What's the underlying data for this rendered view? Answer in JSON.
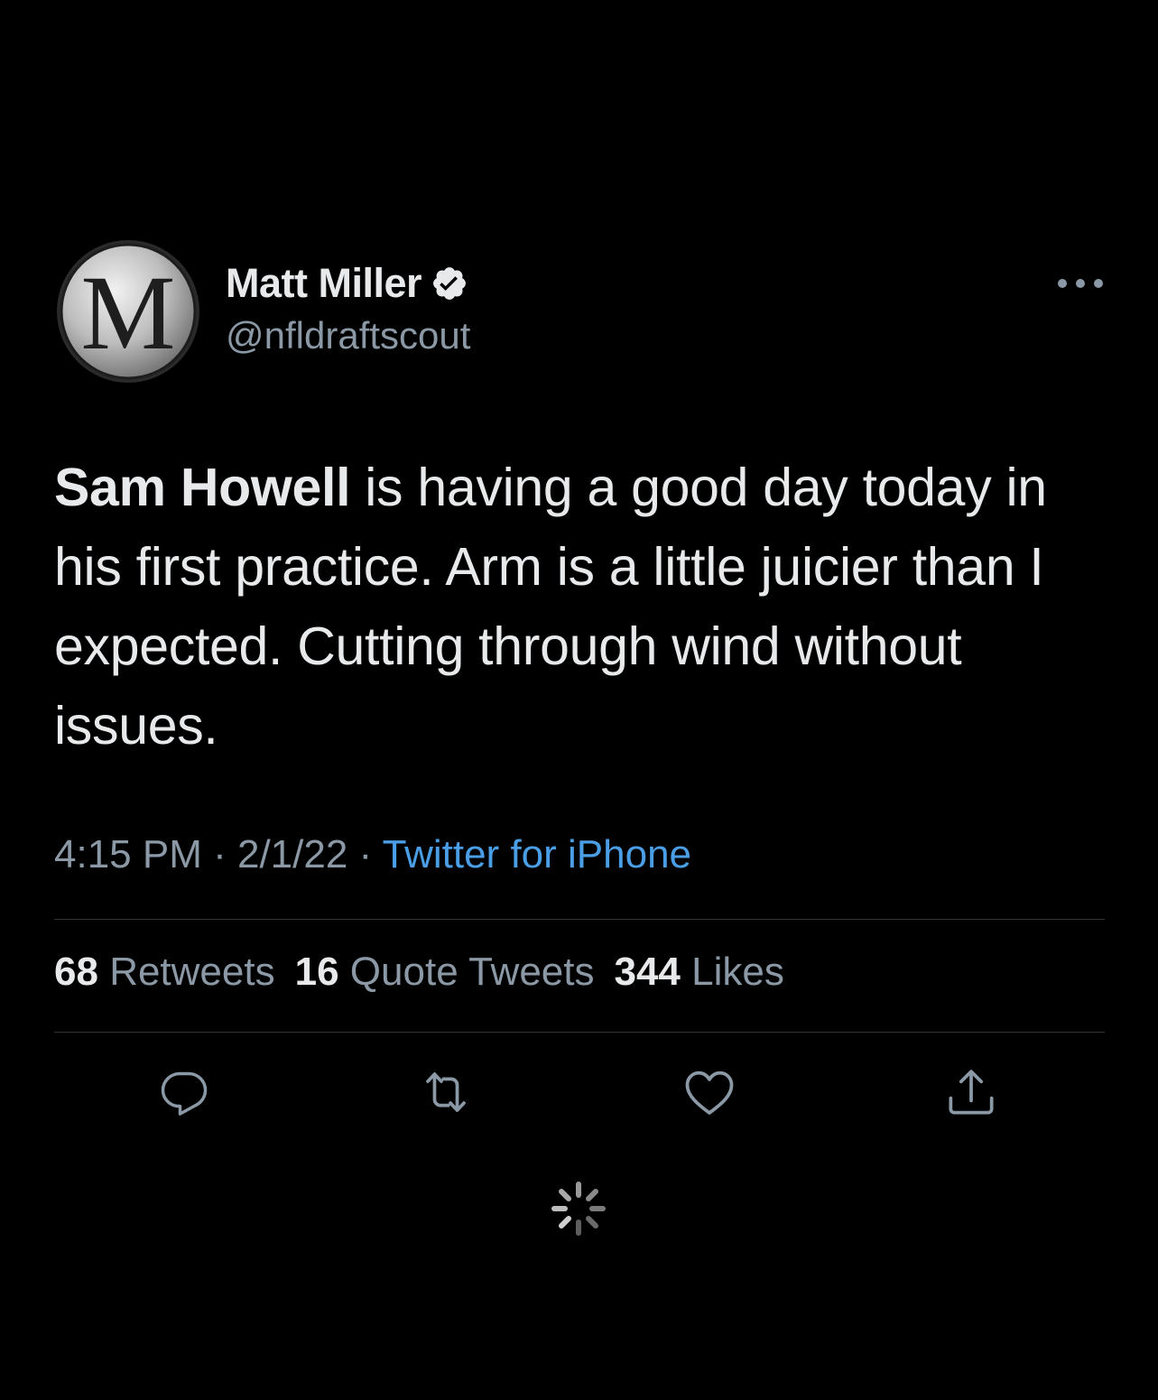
{
  "author": {
    "display_name": "Matt Miller",
    "handle": "@nfldraftscout",
    "avatar_letter": "M",
    "verified": true
  },
  "tweet": {
    "text_bold": "Sam Howell",
    "text_rest": " is having a good day today in his first practice. Arm is a little juicier than I expected. Cutting through wind without issues.",
    "time": "4:15 PM",
    "separator": " · ",
    "date": "2/1/22",
    "source": "Twitter for iPhone"
  },
  "stats": {
    "retweets_count": "68",
    "retweets_label": "Retweets",
    "quotes_count": "16",
    "quotes_label": "Quote Tweets",
    "likes_count": "344",
    "likes_label": "Likes"
  },
  "actions": [
    "reply-icon",
    "retweet-icon",
    "like-icon",
    "share-icon"
  ],
  "colors": {
    "background": "#000000",
    "text_primary": "#e7e9ea",
    "text_secondary": "#8b98a5",
    "link": "#4a9ee6",
    "divider": "#2f3336"
  }
}
